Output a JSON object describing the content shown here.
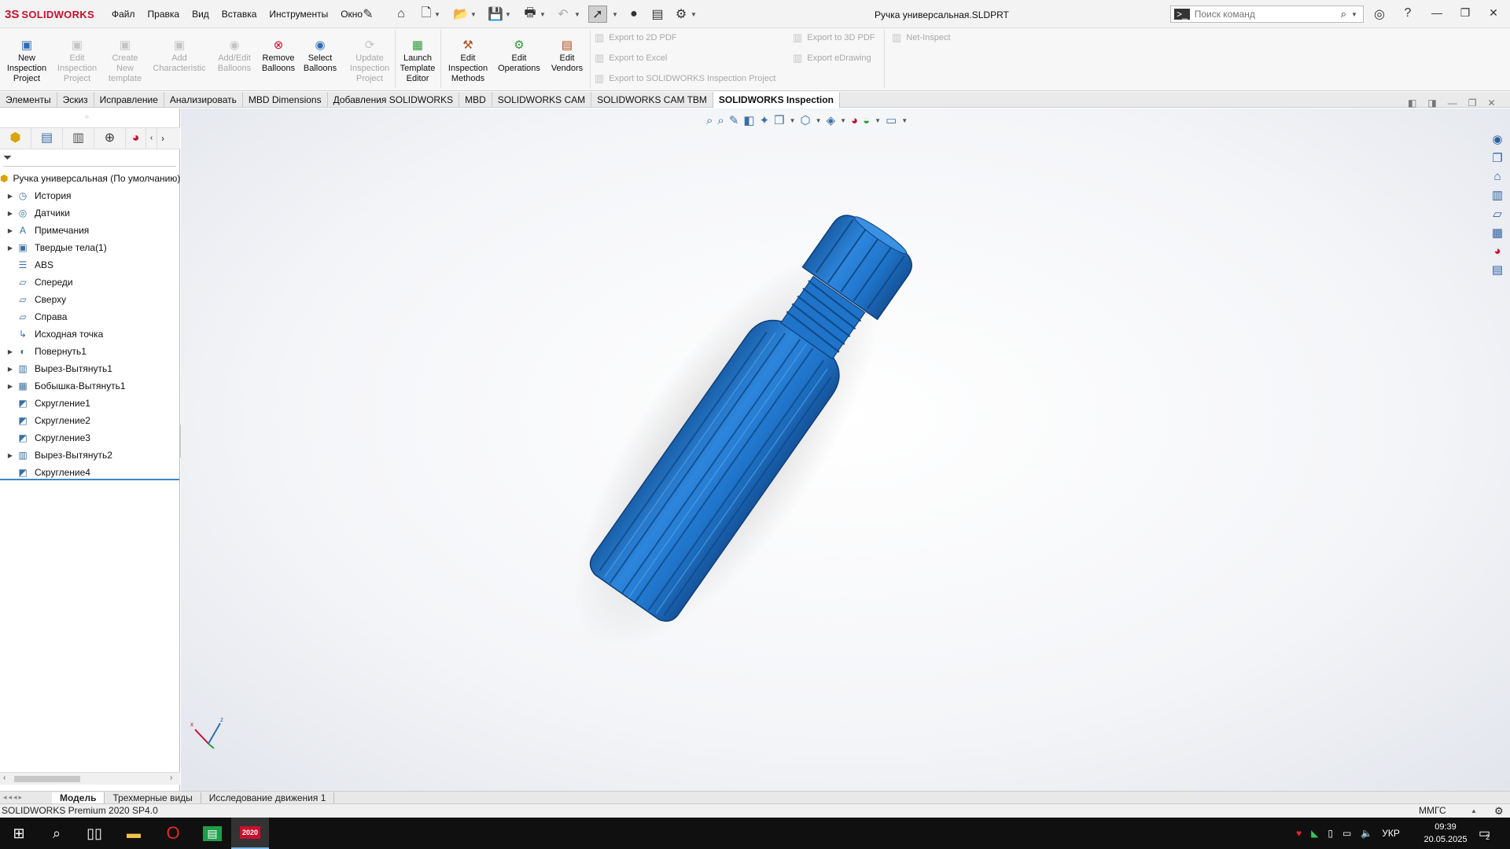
{
  "app": {
    "logo_mark": "3S",
    "logo_text": "SOLIDWORKS",
    "menu": [
      "Файл",
      "Правка",
      "Вид",
      "Вставка",
      "Инструменты",
      "Окно"
    ],
    "document_title": "Ручка универсальная.SLDPRT",
    "search_placeholder": "Поиск команд"
  },
  "ribbon": {
    "buttons": [
      {
        "label": "New Inspection Project",
        "enabled": true,
        "icon": "new-project-icon"
      },
      {
        "label": "Edit Inspection Project",
        "enabled": false,
        "icon": "edit-project-icon"
      },
      {
        "label": "Create New template",
        "enabled": false,
        "icon": "create-template-icon"
      },
      {
        "label": "Add Characteristic",
        "enabled": false,
        "icon": "add-characteristic-icon"
      },
      {
        "label": "Add/Edit Balloons",
        "enabled": false,
        "icon": "balloon-icon"
      },
      {
        "label": "Remove Balloons",
        "enabled": true,
        "icon": "remove-balloon-icon"
      },
      {
        "label": "Select Balloons",
        "enabled": true,
        "icon": "select-balloon-icon"
      },
      {
        "label": "Update Inspection Project",
        "enabled": false,
        "icon": "update-icon"
      },
      {
        "label": "Launch Template Editor",
        "enabled": true,
        "icon": "template-editor-icon"
      },
      {
        "label": "Edit Inspection Methods",
        "enabled": true,
        "icon": "methods-icon"
      },
      {
        "label": "Edit Operations",
        "enabled": true,
        "icon": "operations-icon"
      },
      {
        "label": "Edit Vendors",
        "enabled": true,
        "icon": "vendors-icon"
      }
    ],
    "exports_col1": [
      "Export to 2D PDF",
      "Export to Excel",
      "Export to SOLIDWORKS Inspection Project"
    ],
    "exports_col2": [
      "Export to 3D PDF",
      "Export eDrawing"
    ],
    "net_inspect": "Net-Inspect"
  },
  "tabs": [
    {
      "label": "Элементы",
      "active": false
    },
    {
      "label": "Эскиз",
      "active": false
    },
    {
      "label": "Исправление",
      "active": false
    },
    {
      "label": "Анализировать",
      "active": false
    },
    {
      "label": "MBD Dimensions",
      "active": false
    },
    {
      "label": "Добавления SOLIDWORKS",
      "active": false
    },
    {
      "label": "MBD",
      "active": false
    },
    {
      "label": "SOLIDWORKS CAM",
      "active": false
    },
    {
      "label": "SOLIDWORKS CAM TBM",
      "active": false
    },
    {
      "label": "SOLIDWORKS Inspection",
      "active": true
    }
  ],
  "tree": [
    {
      "label": "Ручка универсальная  (По умолчанию)",
      "expandable": false,
      "root": true,
      "icon": "part-icon"
    },
    {
      "label": "История",
      "expandable": true,
      "icon": "history-icon"
    },
    {
      "label": "Датчики",
      "expandable": true,
      "icon": "sensor-icon"
    },
    {
      "label": "Примечания",
      "expandable": true,
      "icon": "annotation-icon"
    },
    {
      "label": "Твердые тела(1)",
      "expandable": true,
      "icon": "solid-bodies-icon"
    },
    {
      "label": "ABS",
      "expandable": false,
      "icon": "material-icon"
    },
    {
      "label": "Спереди",
      "expandable": false,
      "icon": "plane-icon"
    },
    {
      "label": "Сверху",
      "expandable": false,
      "icon": "plane-icon"
    },
    {
      "label": "Справа",
      "expandable": false,
      "icon": "plane-icon"
    },
    {
      "label": "Исходная точка",
      "expandable": false,
      "icon": "origin-icon"
    },
    {
      "label": "Повернуть1",
      "expandable": true,
      "icon": "revolve-icon"
    },
    {
      "label": "Вырез-Вытянуть1",
      "expandable": true,
      "icon": "cut-extrude-icon"
    },
    {
      "label": "Бобышка-Вытянуть1",
      "expandable": true,
      "icon": "boss-extrude-icon"
    },
    {
      "label": "Скругление1",
      "expandable": false,
      "icon": "fillet-icon"
    },
    {
      "label": "Скругление2",
      "expandable": false,
      "icon": "fillet-icon"
    },
    {
      "label": "Скругление3",
      "expandable": false,
      "icon": "fillet-icon"
    },
    {
      "label": "Вырез-Вытянуть2",
      "expandable": true,
      "icon": "cut-extrude-icon"
    },
    {
      "label": "Скругление4",
      "expandable": false,
      "icon": "fillet-icon"
    }
  ],
  "bottom_tabs": [
    {
      "label": "Модель",
      "active": true
    },
    {
      "label": "Трехмерные виды",
      "active": false
    },
    {
      "label": "Исследование движения 1",
      "active": false
    }
  ],
  "status": {
    "left": "SOLIDWORKS Premium 2020 SP4.0",
    "units": "ММГС"
  },
  "taskbar": {
    "lang": "УКР",
    "time": "09:39",
    "date": "20.05.2025",
    "notifications": "2",
    "sw_badge": "2020"
  },
  "triad": {
    "x": "x",
    "z": "z"
  },
  "colors": {
    "accent": "#c8102e",
    "model_blue": "#1f74c9",
    "selection": "#3a87c8"
  }
}
